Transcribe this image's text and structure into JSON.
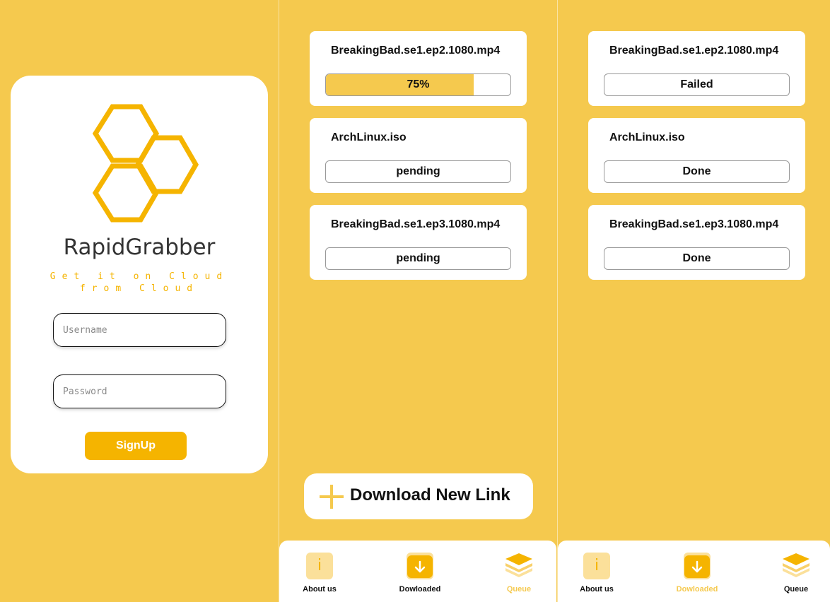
{
  "login": {
    "app_name": "RapidGrabber",
    "tagline_line1": "Get it on Cloud",
    "tagline_line2": "from Cloud",
    "username_placeholder": "Username",
    "password_placeholder": "Password",
    "signup_label": "SignUp"
  },
  "queue_screen": {
    "downloads": [
      {
        "filename": "BreakingBad.se1.ep2.1080.mp4",
        "status": "75%",
        "progress": 0.8
      },
      {
        "filename": "ArchLinux.iso",
        "status": "pending"
      },
      {
        "filename": "BreakingBad.se1.ep3.1080.mp4",
        "status": "pending"
      }
    ],
    "new_link_label": "Download New Link"
  },
  "downloaded_screen": {
    "downloads": [
      {
        "filename": "BreakingBad.se1.ep2.1080.mp4",
        "status": "Failed"
      },
      {
        "filename": "ArchLinux.iso",
        "status": "Done"
      },
      {
        "filename": "BreakingBad.se1.ep3.1080.mp4",
        "status": "Done"
      }
    ]
  },
  "nav": {
    "about": "About us",
    "downloaded": "Dowloaded",
    "queue": "Queue"
  },
  "colors": {
    "background": "#F5C94E",
    "accent": "#F5B400",
    "icon_bg": "#FBE09A"
  }
}
